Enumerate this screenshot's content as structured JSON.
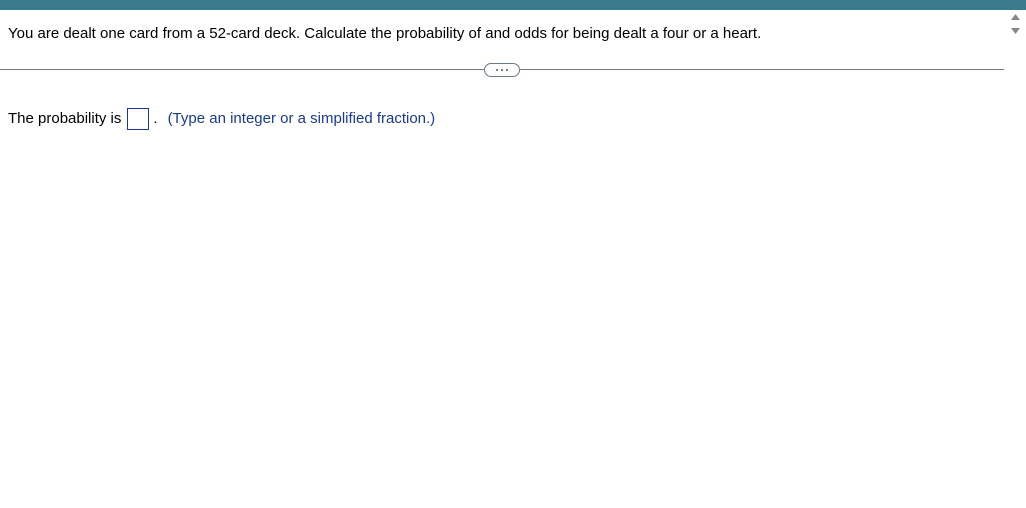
{
  "question": {
    "text": "You are dealt one card from a 52-card deck.  Calculate the probability of and odds for being dealt a four or a heart."
  },
  "answer": {
    "label_prefix": "The probability is",
    "input_value": "",
    "period": ".",
    "hint": "(Type an integer or a simplified fraction.)"
  },
  "icons": {
    "divider_toggle": "more-icon",
    "spinner_up": "chevron-up-icon",
    "spinner_down": "chevron-down-icon"
  }
}
